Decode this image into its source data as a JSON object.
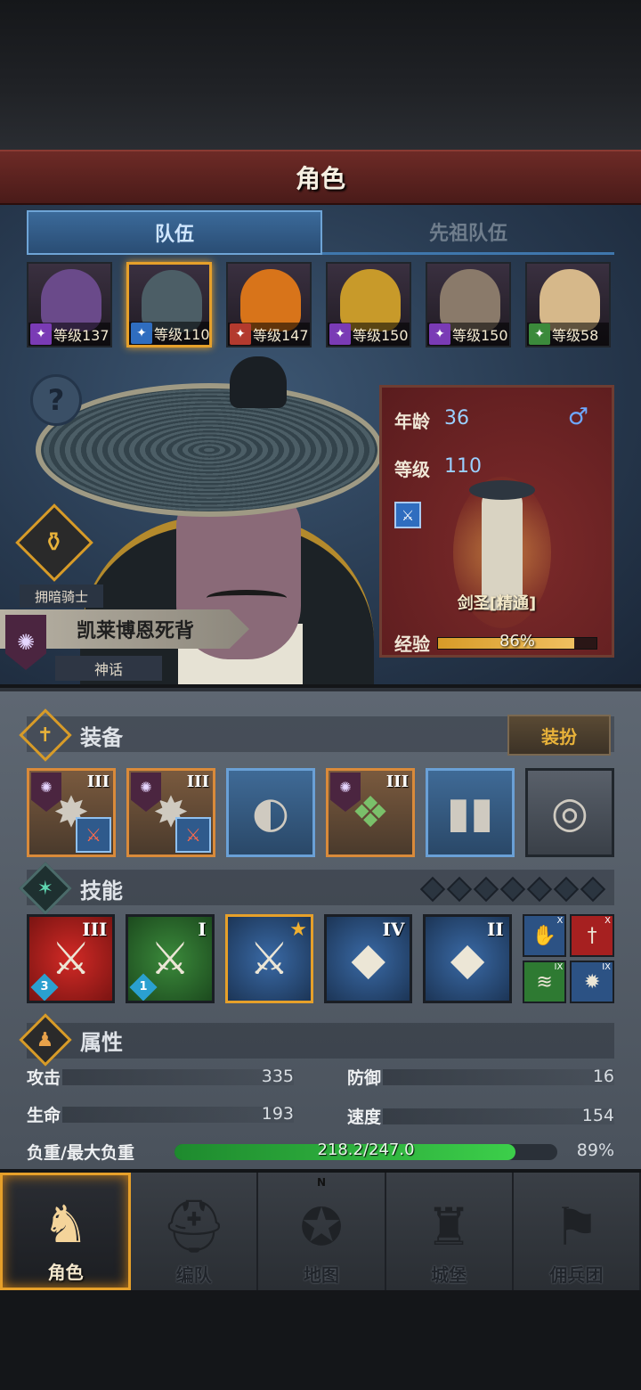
{
  "header": {
    "title": "角色"
  },
  "tabs": [
    {
      "label": "队伍",
      "active": true
    },
    {
      "label": "先祖队伍",
      "active": false
    }
  ],
  "roster": [
    {
      "level_text": "等级137",
      "class_color": "purple",
      "face_color": "#6a4a8a",
      "selected": false
    },
    {
      "level_text": "等级110",
      "class_color": "blue",
      "face_color": "#4c5e66",
      "selected": true
    },
    {
      "level_text": "等级147",
      "class_color": "red",
      "face_color": "#d8741a",
      "selected": false
    },
    {
      "level_text": "等级150",
      "class_color": "purple",
      "face_color": "#c89a2a",
      "selected": false
    },
    {
      "level_text": "等级150",
      "class_color": "purple",
      "face_color": "#8a7a6a",
      "selected": false
    },
    {
      "level_text": "等级58",
      "class_color": "green",
      "face_color": "#d6b88a",
      "selected": false
    }
  ],
  "character": {
    "title": "拥暗骑士",
    "name": "凯莱博恩死背",
    "rarity": "神话",
    "age_label": "年龄",
    "age": "36",
    "level_label": "等级",
    "level": "110",
    "job": "剑圣[精通]",
    "xp_label": "经验",
    "xp_percent": 86,
    "xp_text": "86%",
    "gender_symbol": "♂"
  },
  "equipment": {
    "section_label": "装备",
    "dress_button": "装扮",
    "slots": [
      {
        "style": "orange",
        "tier": "III",
        "glyph": "✸",
        "has_faction": true,
        "has_sub": true
      },
      {
        "style": "orange",
        "tier": "III",
        "glyph": "✸",
        "has_faction": true,
        "has_sub": true
      },
      {
        "style": "blue",
        "tier": "",
        "glyph": "◐",
        "has_faction": false,
        "has_sub": false
      },
      {
        "style": "orange",
        "tier": "III",
        "glyph": "❖",
        "has_faction": true,
        "has_sub": false
      },
      {
        "style": "blue",
        "tier": "",
        "glyph": "❙❙",
        "has_faction": false,
        "has_sub": false
      },
      {
        "style": "gray",
        "tier": "",
        "glyph": "◎",
        "has_faction": false,
        "has_sub": false
      }
    ]
  },
  "skills": {
    "section_label": "技能",
    "gem_slots": 7,
    "items": [
      {
        "color": "red",
        "tier": "III",
        "gem": "3"
      },
      {
        "color": "green",
        "tier": "I",
        "gem": "1"
      },
      {
        "color": "blue",
        "tier": "",
        "gem": "",
        "starred": true
      },
      {
        "color": "blue",
        "tier": "IV",
        "gem": ""
      },
      {
        "color": "blue",
        "tier": "II",
        "gem": ""
      }
    ],
    "mini": [
      {
        "color": "blue",
        "n": "X"
      },
      {
        "color": "red",
        "n": "X"
      },
      {
        "color": "green",
        "n": "IX"
      },
      {
        "color": "blue",
        "n": "IX"
      }
    ]
  },
  "attributes": {
    "section_label": "属性",
    "attack_label": "攻击",
    "attack": "335",
    "defense_label": "防御",
    "defense": "16",
    "hp_label": "生命",
    "hp": "193",
    "speed_label": "速度",
    "speed": "154",
    "load_label": "负重/最大负重",
    "load_text": "218.2/247.0",
    "load_percent": 89,
    "load_pct_text": "89%"
  },
  "nav": [
    {
      "label": "角色",
      "active": true,
      "icon": "knight-icon"
    },
    {
      "label": "编队",
      "active": false,
      "icon": "helmet-icon"
    },
    {
      "label": "地图",
      "active": false,
      "icon": "compass-icon"
    },
    {
      "label": "城堡",
      "active": false,
      "icon": "castle-icon"
    },
    {
      "label": "佣兵团",
      "active": false,
      "icon": "banner-icon"
    }
  ]
}
